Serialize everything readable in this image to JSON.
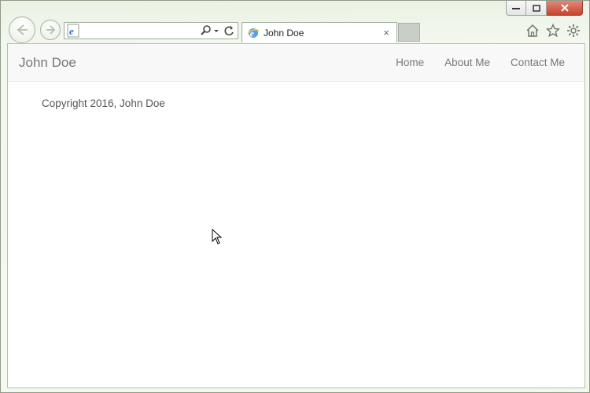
{
  "browser": {
    "address_value": "",
    "tab_title": "John Doe",
    "tab_close_glyph": "×",
    "caption_buttons": [
      "minimize",
      "restore",
      "close"
    ]
  },
  "site": {
    "brand": "John Doe",
    "menu": [
      "Home",
      "About Me",
      "Contact Me"
    ],
    "footer": "Copyright 2016, John Doe"
  },
  "colors": {
    "ie_blue": "#1e6fc8",
    "nav_bg": "#f8f8f8",
    "link": "#777777"
  }
}
